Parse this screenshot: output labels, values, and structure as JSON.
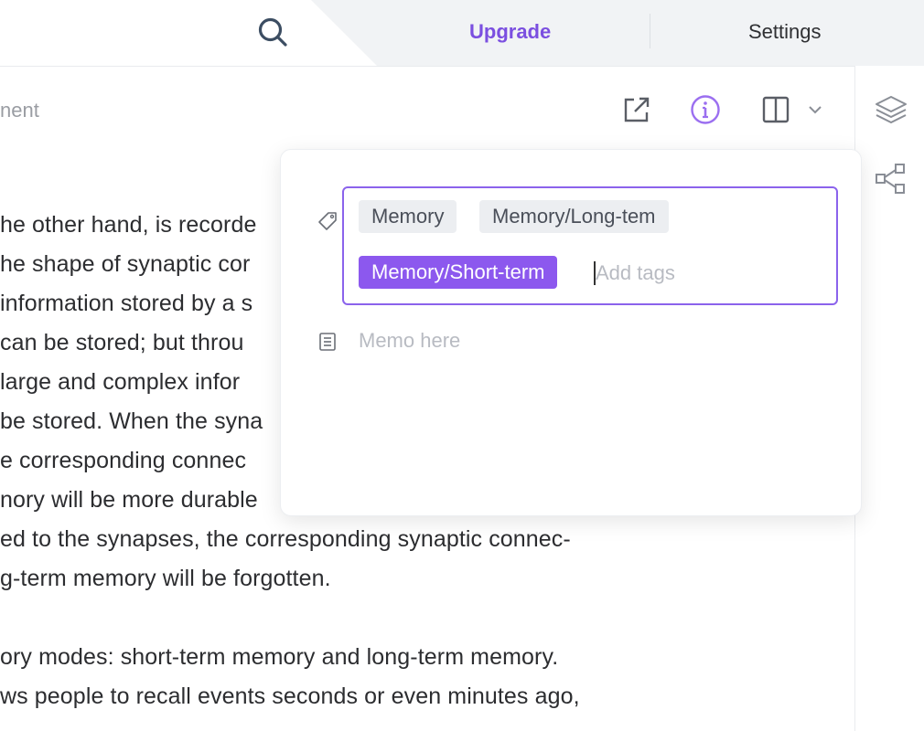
{
  "header": {
    "upgrade_label": "Upgrade",
    "settings_label": "Settings",
    "search_icon": "search-icon",
    "accent_color": "#7b4fe0"
  },
  "toolbar": {
    "breadcrumb": "nent",
    "icons": [
      "open-external-icon",
      "info-icon",
      "split-view-icon",
      "chevron-down-icon"
    ]
  },
  "sidebar": {
    "icons": [
      "layers-icon",
      "graph-icon"
    ]
  },
  "document": {
    "lines": [
      "he other hand, is recorde",
      "he shape of synaptic cor",
      "information stored by a s",
      "can be stored; but throu",
      "large and complex infor",
      "be stored. When the syna",
      "e corresponding connec",
      "nory will be more durable",
      "ed to the synapses, the corresponding synaptic connec-",
      "g-term memory will be forgotten.",
      "ory modes: short-term memory and long-term memory.",
      "ws people to recall events seconds or even minutes ago,"
    ]
  },
  "popover": {
    "tags": [
      {
        "label": "Memory",
        "selected": false
      },
      {
        "label": "Memory/Long-tem",
        "selected": false
      },
      {
        "label": "Memory/Short-term",
        "selected": true
      }
    ],
    "tag_input_placeholder": "Add tags",
    "tag_input_value": "",
    "memo_placeholder": "Memo here",
    "memo_value": "",
    "selected_color": "#8c58ee"
  }
}
